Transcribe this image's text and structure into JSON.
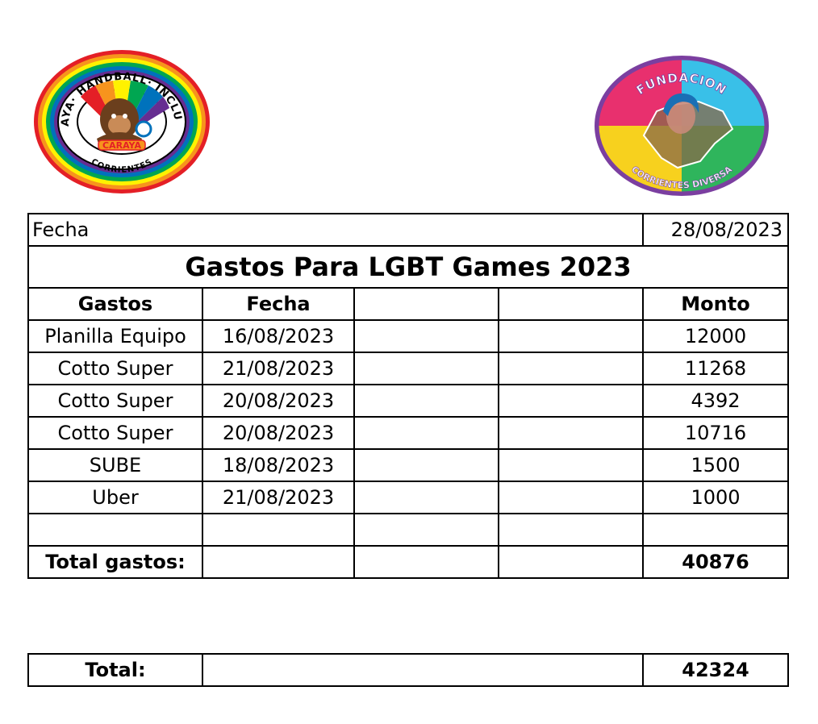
{
  "logos": {
    "left": {
      "name": "Caraya Handball Inclusivo logo",
      "arc_top": "CARAYA· HANDBALL· INCLUSIVO",
      "wordmark": "CARAYA",
      "arc_bottom": "CORRIENTES",
      "colors": [
        "#e41f26",
        "#f7941d",
        "#fff200",
        "#00a651",
        "#0072bc",
        "#662d91"
      ]
    },
    "right": {
      "name": "Fundacion Corrientes Diversa logo",
      "arc_top": "FUNDACION",
      "arc_bottom": "CORRIENTES DIVERSA",
      "colors": [
        "#e8306e",
        "#39c0e8",
        "#f7d11e",
        "#2fb55c",
        "#7b3fa0"
      ]
    }
  },
  "header": {
    "fecha_label": "Fecha",
    "fecha_value": "28/08/2023",
    "title": "Gastos Para LGBT Games 2023"
  },
  "columns": [
    "Gastos",
    "Fecha",
    "",
    "",
    "Monto"
  ],
  "rows": [
    {
      "gasto": "Planilla Equipo",
      "fecha": "16/08/2023",
      "monto": "12000"
    },
    {
      "gasto": "Cotto Super",
      "fecha": "21/08/2023",
      "monto": "11268"
    },
    {
      "gasto": "Cotto Super",
      "fecha": "20/08/2023",
      "monto": "4392"
    },
    {
      "gasto": "Cotto Super",
      "fecha": "20/08/2023",
      "monto": "10716"
    },
    {
      "gasto": "SUBE",
      "fecha": "18/08/2023",
      "monto": "1500"
    },
    {
      "gasto": "Uber",
      "fecha": "21/08/2023",
      "monto": "1000"
    },
    {
      "gasto": "",
      "fecha": "",
      "monto": ""
    }
  ],
  "total_gastos": {
    "label": "Total gastos:",
    "value": "40876"
  },
  "total": {
    "label": "Total:",
    "value": "42324"
  }
}
